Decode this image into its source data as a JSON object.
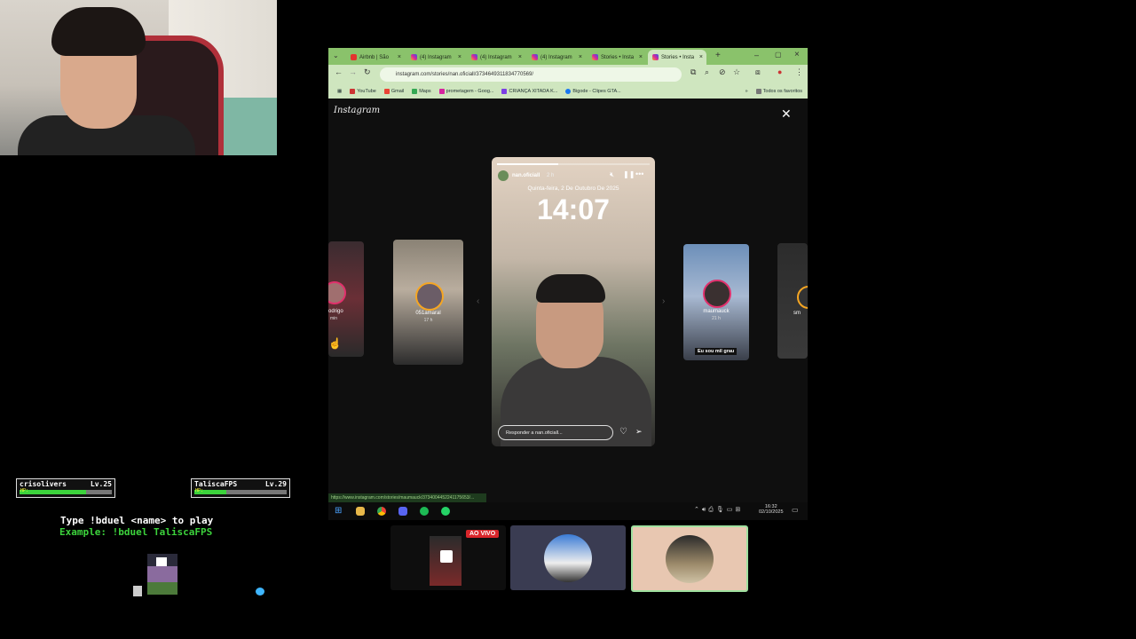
{
  "browser": {
    "tabs": [
      {
        "label": "Airbnb | São",
        "icon": "airbnb-icon"
      },
      {
        "label": "(4) Instagram",
        "icon": "instagram-icon"
      },
      {
        "label": "(4) Instagram",
        "icon": "instagram-icon"
      },
      {
        "label": "(4) Instagram",
        "icon": "instagram-icon"
      },
      {
        "label": "Stories • Insta",
        "icon": "instagram-icon"
      },
      {
        "label": "Stories • Insta",
        "icon": "instagram-icon"
      }
    ],
    "url": "instagram.com/stories/nan.oficiall/3734649311834770569/",
    "bookmarks": [
      "YouTube",
      "Gmail",
      "Maps",
      "prometagem - Goog...",
      "CRIANÇA XITADA K...",
      "Bigode - Clipes GTA...",
      "Todos os favoritos"
    ],
    "status_url": "https://www.instagram.com/stories/maumauck/3734004452241175653/..."
  },
  "instagram": {
    "logo": "Instagram",
    "left_story_1": {
      "name": "odrigo",
      "time": "min"
    },
    "left_story_2": {
      "name": "051amaral",
      "time": "17 h"
    },
    "right_story_1": {
      "name": "maumauck",
      "time": "21 h",
      "caption": "Eu sou mil grau"
    },
    "right_story_2": {
      "name": "sm"
    },
    "main_story": {
      "username": "nan.oficiall",
      "time": "2 h",
      "date": "Quinta-feira, 2 De Outubro De 2025",
      "clock": "14:07",
      "reply_placeholder": "Responder a nan.oficiall..."
    }
  },
  "taskbar": {
    "time": "16:32",
    "date": "02/10/2025"
  },
  "overlay": {
    "player1": {
      "name": "crisolivers",
      "level": "Lv.25",
      "hp_label": "HP:",
      "hp": 0.72
    },
    "player2": {
      "name": "TaliscaFPS",
      "level": "Lv.29",
      "hp_label": "HP:",
      "hp": 0.35
    },
    "instructions": "Type !bduel <name> to play",
    "example": "Example: !bduel TaliscaFPS"
  },
  "live_badge": "AO VIVO"
}
